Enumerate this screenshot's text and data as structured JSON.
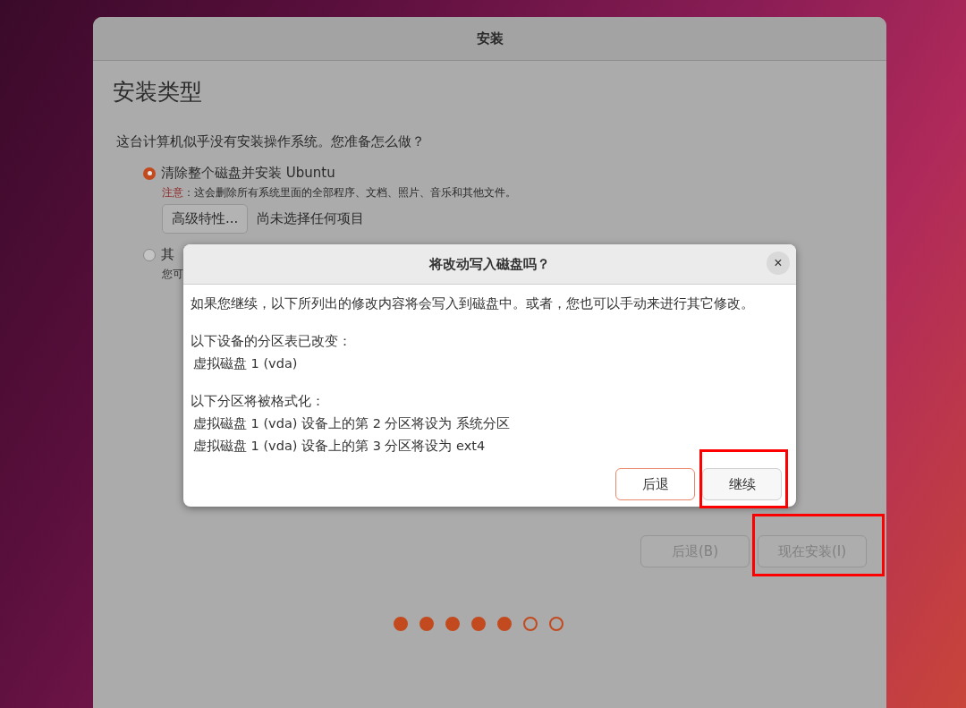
{
  "window": {
    "title": "安装"
  },
  "page": {
    "heading": "安装类型",
    "question": "这台计算机似乎没有安装操作系统。您准备怎么做？",
    "options": [
      {
        "label": "清除整个磁盘并安装 Ubuntu",
        "selected": true,
        "note_label": "注意",
        "note": "：这会删除所有系统里面的全部程序、文档、照片、音乐和其他文件。",
        "button": "高级特性...",
        "status": "尚未选择任何项目"
      },
      {
        "label": "其",
        "selected": false,
        "description": "您可"
      }
    ],
    "buttons": [
      {
        "label": "后退(B)",
        "disabled": true,
        "highlighted": false
      },
      {
        "label": "现在安装(I)",
        "disabled": true,
        "highlighted": true
      }
    ],
    "steps": [
      {
        "completed": true
      },
      {
        "completed": true
      },
      {
        "completed": true
      },
      {
        "completed": true
      },
      {
        "completed": true
      },
      {
        "completed": false
      },
      {
        "completed": false
      }
    ]
  },
  "dialog": {
    "title": "将改动写入磁盘吗？",
    "close": "×",
    "intro": "如果您继续，以下所列出的修改内容将会写入到磁盘中。或者，您也可以手动来进行其它修改。",
    "sections": [
      {
        "heading": "以下设备的分区表已改变：",
        "items": [
          "虚拟磁盘 1 (vda)"
        ]
      },
      {
        "heading": "以下分区将被格式化：",
        "items": [
          "虚拟磁盘 1 (vda) 设备上的第 2 分区将设为 系统分区",
          "虚拟磁盘 1 (vda) 设备上的第 3 分区将设为 ext4"
        ]
      }
    ],
    "buttons": [
      {
        "label": "后退",
        "kind": "suggested",
        "highlighted": false
      },
      {
        "label": "继续",
        "kind": "normal",
        "highlighted": true
      }
    ]
  }
}
